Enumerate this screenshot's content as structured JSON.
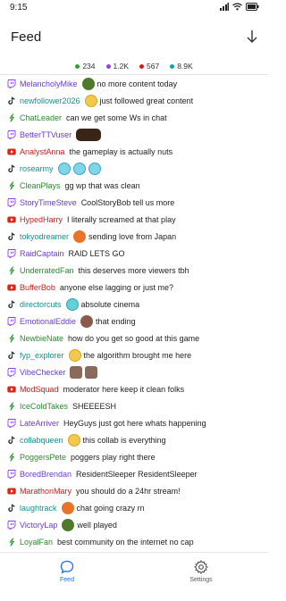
{
  "status_bar": {
    "time": "9:15"
  },
  "header": {
    "title": "Feed"
  },
  "counts": [
    {
      "platform": "kick",
      "color": "#2e9e35",
      "value": "234"
    },
    {
      "platform": "twitch",
      "color": "#8a3ffc",
      "value": "1.2K"
    },
    {
      "platform": "youtube",
      "color": "#d81b1b",
      "value": "567"
    },
    {
      "platform": "tiktok",
      "color": "#13a3a3",
      "value": "8.9K"
    }
  ],
  "messages": [
    {
      "platform": "twitch",
      "user": "MelancholyMike",
      "user_color": "#6a3dd1",
      "emotes": [
        "pepe-emote"
      ],
      "text": "no more content today"
    },
    {
      "platform": "tiktok",
      "user": "newfollower2026",
      "user_color": "#16908f",
      "emotes": [
        "blob-emote"
      ],
      "text": "just followed great content"
    },
    {
      "platform": "kick",
      "user": "ChatLeader",
      "user_color": "#2c8a2f",
      "emotes": [],
      "text": "can we get some Ws in chat"
    },
    {
      "platform": "twitch",
      "user": "BetterTTVuser",
      "user_color": "#6a3dd1",
      "emotes": [
        "glasses-emote"
      ],
      "text": ""
    },
    {
      "platform": "youtube",
      "user": "AnalystAnna",
      "user_color": "#c42222",
      "emotes": [],
      "text": "the gameplay is actually nuts"
    },
    {
      "platform": "tiktok",
      "user": "rosearmy",
      "user_color": "#16908f",
      "emotes": [
        "face-emote",
        "face-emote",
        "face-emote"
      ],
      "text": ""
    },
    {
      "platform": "kick",
      "user": "CleanPlays",
      "user_color": "#2c8a2f",
      "emotes": [],
      "text": "gg wp that was clean"
    },
    {
      "platform": "twitch",
      "user": "StoryTimeSteve",
      "user_color": "#6a3dd1",
      "emotes": [],
      "text": "CoolStoryBob tell us more"
    },
    {
      "platform": "youtube",
      "user": "HypedHarry",
      "user_color": "#c42222",
      "emotes": [],
      "text": "I literally screamed at that play"
    },
    {
      "platform": "tiktok",
      "user": "tokyodreamer",
      "user_color": "#16908f",
      "emotes": [
        "fox-emote"
      ],
      "text": "sending love from Japan"
    },
    {
      "platform": "twitch",
      "user": "RaidCaptain",
      "user_color": "#6a3dd1",
      "emotes": [],
      "text": "RAID LETS GO"
    },
    {
      "platform": "kick",
      "user": "UnderratedFan",
      "user_color": "#2c8a2f",
      "emotes": [],
      "text": "this deserves more viewers tbh"
    },
    {
      "platform": "youtube",
      "user": "BufferBob",
      "user_color": "#c42222",
      "emotes": [],
      "text": "anyone else lagging or just me?"
    },
    {
      "platform": "tiktok",
      "user": "directorcuts",
      "user_color": "#16908f",
      "emotes": [
        "teal-emote"
      ],
      "text": "absolute cinema"
    },
    {
      "platform": "twitch",
      "user": "EmotionalEddie",
      "user_color": "#6a3dd1",
      "emotes": [
        "sad-emote"
      ],
      "text": "that ending"
    },
    {
      "platform": "kick",
      "user": "NewbieNate",
      "user_color": "#2c8a2f",
      "emotes": [],
      "text": "how do you get so good at this game"
    },
    {
      "platform": "tiktok",
      "user": "fyp_explorer",
      "user_color": "#16908f",
      "emotes": [
        "blob-emote"
      ],
      "text": "the algorithm brought me here"
    },
    {
      "platform": "twitch",
      "user": "VibeChecker",
      "user_color": "#6a3dd1",
      "emotes": [
        "cat-emote",
        "cat-emote"
      ],
      "text": ""
    },
    {
      "platform": "youtube",
      "user": "ModSquad",
      "user_color": "#c42222",
      "emotes": [],
      "text": "moderator here keep it clean folks"
    },
    {
      "platform": "kick",
      "user": "IceColdTakes",
      "user_color": "#2c8a2f",
      "emotes": [],
      "text": "SHEEEESH"
    },
    {
      "platform": "twitch",
      "user": "LateArriver",
      "user_color": "#6a3dd1",
      "emotes": [],
      "text": "HeyGuys just got here whats happening"
    },
    {
      "platform": "tiktok",
      "user": "collabqueen",
      "user_color": "#16908f",
      "emotes": [
        "blob-emote"
      ],
      "text": "this collab is everything"
    },
    {
      "platform": "kick",
      "user": "PoggersPete",
      "user_color": "#2c8a2f",
      "emotes": [],
      "text": "poggers play right there"
    },
    {
      "platform": "twitch",
      "user": "BoredBrendan",
      "user_color": "#6a3dd1",
      "emotes": [],
      "text": "ResidentSleeper ResidentSleeper"
    },
    {
      "platform": "youtube",
      "user": "MarathonMary",
      "user_color": "#c42222",
      "emotes": [],
      "text": "you should do a 24hr stream!"
    },
    {
      "platform": "tiktok",
      "user": "laughtrack",
      "user_color": "#16908f",
      "emotes": [
        "fox-emote"
      ],
      "text": "chat going crazy rn"
    },
    {
      "platform": "twitch",
      "user": "VictoryLap",
      "user_color": "#6a3dd1",
      "emotes": [
        "pepe-emote"
      ],
      "text": "well played"
    },
    {
      "platform": "kick",
      "user": "LoyalFan",
      "user_color": "#2c8a2f",
      "emotes": [],
      "text": "best community on the internet no cap"
    }
  ],
  "nav": {
    "feed_label": "Feed",
    "settings_label": "Settings",
    "active_color": "#1e6fd9"
  }
}
